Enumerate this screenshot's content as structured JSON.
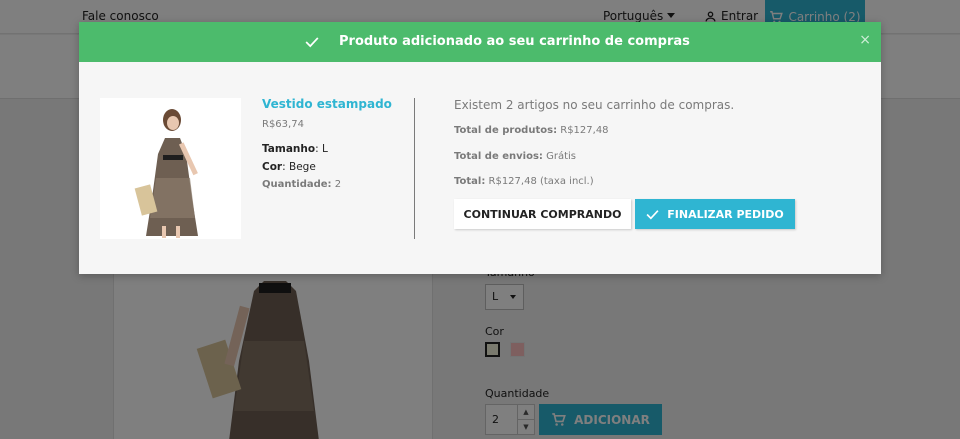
{
  "topbar": {
    "contact": "Fale conosco",
    "language": "Português",
    "sign_in": "Entrar",
    "cart": "Carrinho (2)"
  },
  "product_page": {
    "size_label": "Tamanho",
    "size_value": "L",
    "color_label": "Cor",
    "quantity_label": "Quantidade",
    "quantity_value": "2",
    "add_to_cart": "ADICIONAR"
  },
  "modal": {
    "title": "Produto adicionado ao seu carrinho de compras",
    "close": "×",
    "product_name": "Vestido estampado",
    "product_price": "R$63,74",
    "size_label": "Tamanho",
    "size_value": ": L",
    "color_label": "Cor",
    "color_value": ": Bege",
    "quantity_label": "Quantidade:",
    "quantity_value": " 2",
    "cart_count_text": "Existem 2 artigos no seu carrinho de compras.",
    "total_products_label": "Total de produtos:",
    "total_products_value": " R$127,48",
    "total_shipping_label": "Total de envios:",
    "total_shipping_value": " Grátis",
    "total_label": "Total:",
    "total_value": " R$127,48 (taxa incl.)",
    "continue_button": "CONTINUAR COMPRANDO",
    "checkout_button": "FINALIZAR PEDIDO"
  },
  "colors": {
    "success": "#4cbb6c",
    "accent": "#2fb5d2",
    "swatch_beige": "#f5f5dc",
    "swatch_pink": "#fcbfbf"
  },
  "icons": [
    "caret-down-icon",
    "person-icon",
    "cart-icon",
    "check-icon",
    "close-icon",
    "dress-photo"
  ]
}
